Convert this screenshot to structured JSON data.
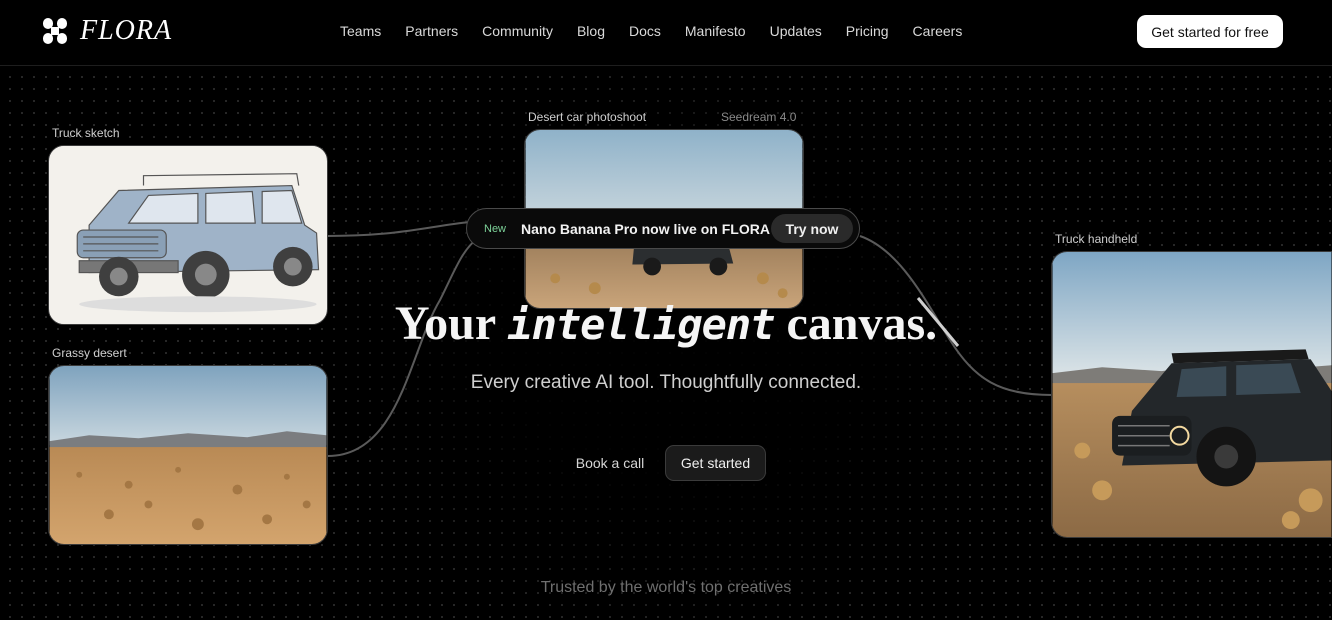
{
  "brand": {
    "name": "FLORA",
    "logo_icon": "flower-logo-icon"
  },
  "nav": {
    "items": [
      "Teams",
      "Partners",
      "Community",
      "Blog",
      "Docs",
      "Manifesto",
      "Updates",
      "Pricing",
      "Careers"
    ],
    "cta_label": "Get started for free"
  },
  "cards": {
    "truck_sketch": {
      "label": "Truck sketch"
    },
    "grassy_desert": {
      "label": "Grassy desert"
    },
    "desert_car": {
      "label": "Desert car photoshoot",
      "model": "Seedream 4.0"
    },
    "truck_handheld": {
      "label": "Truck handheld"
    }
  },
  "banner": {
    "badge": "New",
    "text": "Nano Banana Pro now live on FLORA",
    "button": "Try now"
  },
  "hero": {
    "headline_start": "Your",
    "headline_emphasis": "intelligent",
    "headline_end": "canvas.",
    "subheadline": "Every creative AI tool. Thoughtfully connected.",
    "book_call_label": "Book a call",
    "get_started_label": "Get started"
  },
  "footer": {
    "trusted_text": "Trusted by the world's top creatives"
  },
  "colors": {
    "background": "#000000",
    "accent_new": "#7ed49a",
    "cta_bg": "#ffffff"
  }
}
